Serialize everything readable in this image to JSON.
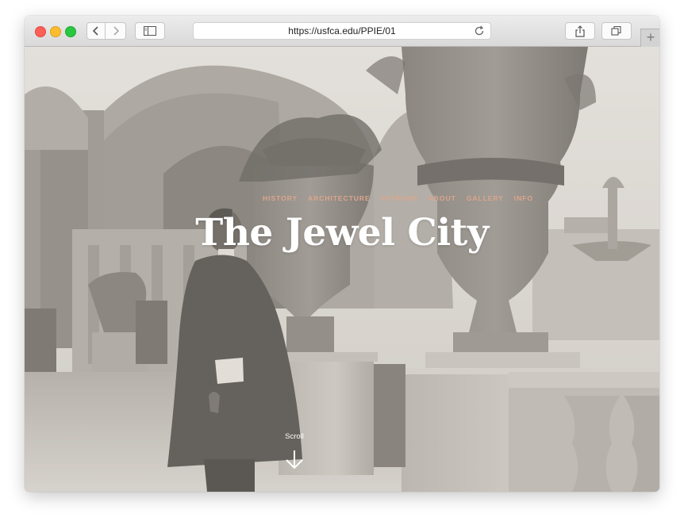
{
  "browser": {
    "url": "https://usfca.edu/PPIE/01",
    "icons": [
      "back-icon",
      "forward-icon",
      "sidebar-icon",
      "reload-icon",
      "share-icon",
      "tabs-icon",
      "plus-icon"
    ],
    "new_tab_label": "+"
  },
  "site": {
    "nav": [
      "HISTORY",
      "ARCHITECTURE",
      "PATRONS",
      "ABOUT",
      "GALLERY",
      "INFO"
    ],
    "title": "The Jewel City",
    "scroll_label": "Scroll",
    "colors": {
      "nav": "#dca68b",
      "title": "#ffffff",
      "photo_tone": "#8f8b84"
    }
  }
}
